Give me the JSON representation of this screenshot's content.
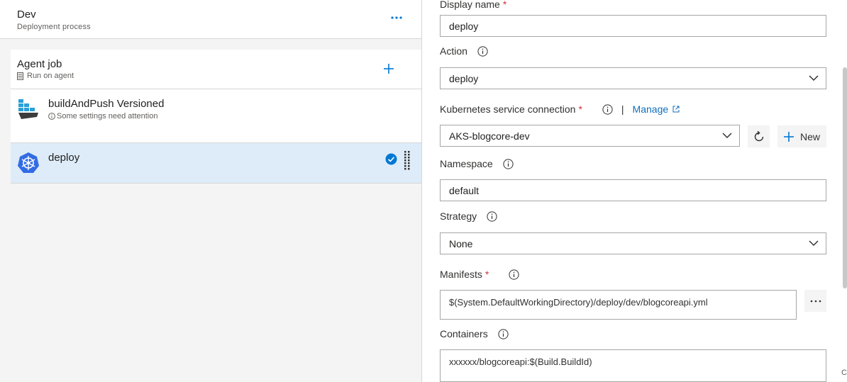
{
  "stage": {
    "title": "Dev",
    "subtitle": "Deployment process"
  },
  "agent_job": {
    "title": "Agent job",
    "subtitle": "Run on agent"
  },
  "tasks": [
    {
      "name": "buildAndPush Versioned",
      "warning": "Some settings need attention",
      "icon": "docker-icon"
    },
    {
      "name": "deploy",
      "icon": "kubernetes-icon",
      "selected": true
    }
  ],
  "form": {
    "display_name": {
      "label": "Display name",
      "value": "deploy"
    },
    "action": {
      "label": "Action",
      "value": "deploy"
    },
    "k8s_connection": {
      "label": "Kubernetes service connection",
      "manage": "Manage",
      "value": "AKS-blogcore-dev",
      "new_label": "New"
    },
    "namespace": {
      "label": "Namespace",
      "value": "default"
    },
    "strategy": {
      "label": "Strategy",
      "value": "None"
    },
    "manifests": {
      "label": "Manifests",
      "value": "$(System.DefaultWorkingDirectory)/deploy/dev/blogcoreapi.yml",
      "more": "..."
    },
    "containers": {
      "label": "Containers",
      "value": "xxxxxx/blogcoreapi:$(Build.BuildId)"
    }
  },
  "edge_text": "C",
  "colors": {
    "accent": "#0078d4",
    "selected_bg": "#deecf9",
    "required": "#d13438",
    "link": "#106ebe"
  }
}
